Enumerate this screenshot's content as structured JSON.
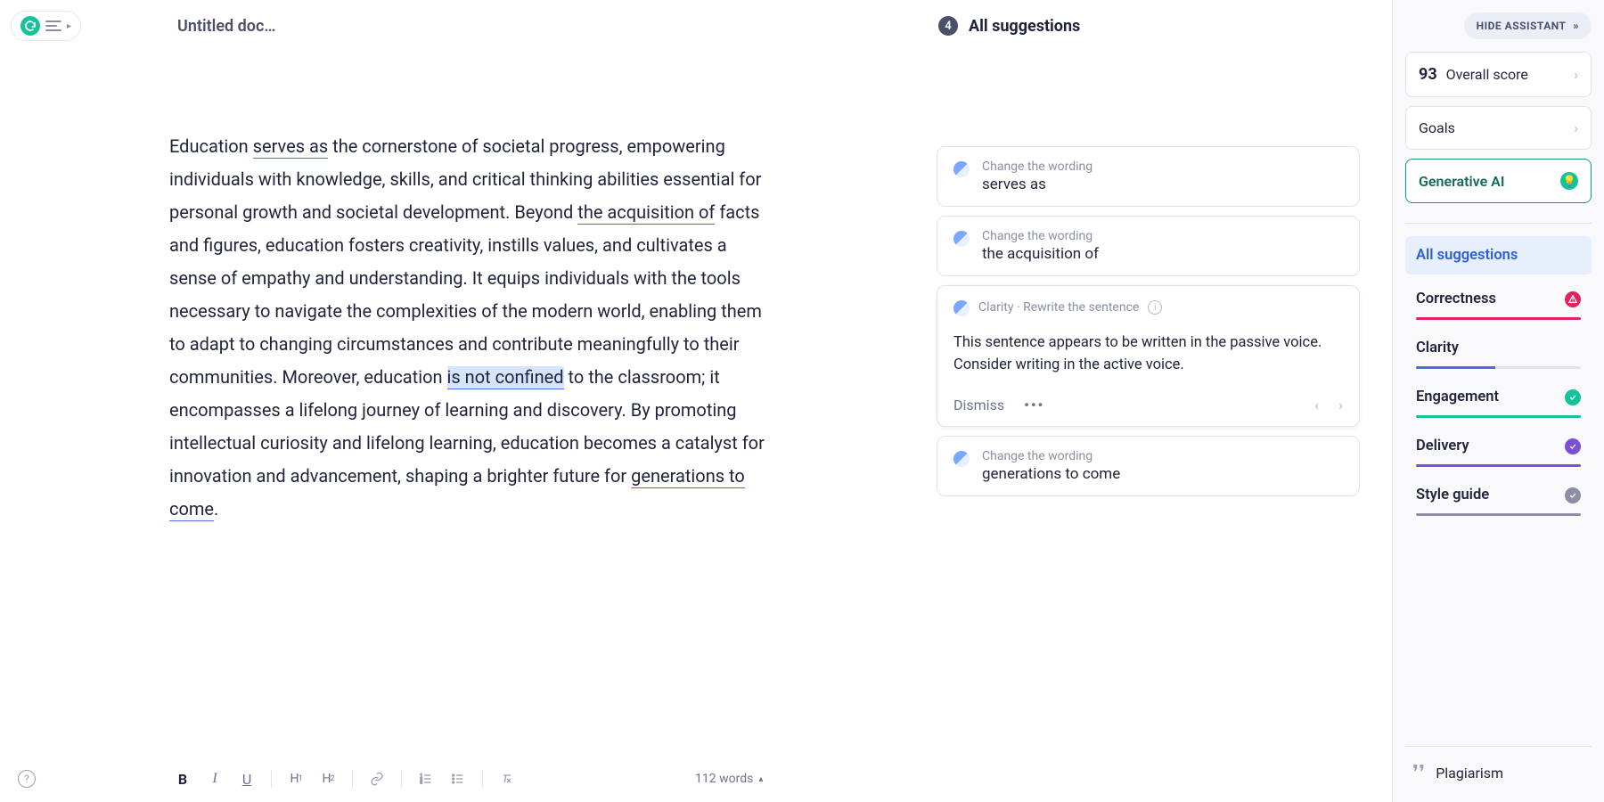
{
  "header": {
    "doc_title": "Untitled docum…",
    "hide_assistant": "HIDE ASSISTANT"
  },
  "editor": {
    "t1": "Education ",
    "u1": "serves as",
    "t2": " the cornerstone of societal progress, empowering individuals with knowledge, skills, and critical thinking abilities essential for personal growth and societal development. Beyond ",
    "u2": "the acquisition of",
    "t3": " facts and figures, education fosters creativity, instills values, and cultivates a sense of empathy and understanding. It equips individuals with the tools necessary to navigate the complexities of the modern world, enabling them to adapt to changing circumstances and contribute meaningfully to their communities. Moreover, education ",
    "h1": "is not confined",
    "t4": " to the classroom; it encompasses a lifelong journey of learning and discovery. By promoting intellectual curiosity and lifelong learning, education becomes a catalyst for innovation and advancement, shaping a brighter future for ",
    "u3": "generations to come",
    "t5": "."
  },
  "toolbar": {
    "bold": "B",
    "italic": "I",
    "underline": "U",
    "h1": "H1",
    "h2": "H2",
    "word_count": "112 words"
  },
  "suggestions": {
    "count": "4",
    "title": "All suggestions",
    "cards": [
      {
        "hint": "Change the wording",
        "text": "serves as"
      },
      {
        "hint": "Change the wording",
        "text": "the acquisition of"
      },
      {
        "hint": "Change the wording",
        "text": "generations to come"
      }
    ],
    "expanded": {
      "category": "Clarity · Rewrite the sentence",
      "body": "This sentence appears to be written in the passive voice. Consider writing in the active voice.",
      "dismiss": "Dismiss"
    }
  },
  "rail": {
    "score_value": "93",
    "score_label": " Overall score",
    "goals": "Goals",
    "gen_ai": "Generative AI",
    "filters": {
      "all": "All suggestions",
      "correctness": "Correctness",
      "clarity": "Clarity",
      "engagement": "Engagement",
      "delivery": "Delivery",
      "style": "Style guide"
    },
    "plagiarism": "Plagiarism"
  }
}
